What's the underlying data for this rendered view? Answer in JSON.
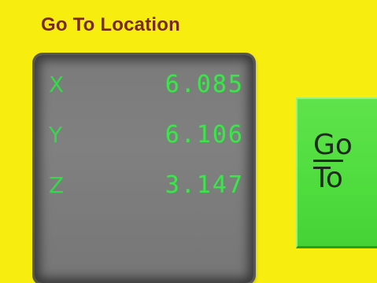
{
  "panel": {
    "title": "Go To Location"
  },
  "coordinates": [
    {
      "axis": "X",
      "value": "6.085"
    },
    {
      "axis": "Y",
      "value": "6.106"
    },
    {
      "axis": "Z",
      "value": "3.147"
    }
  ],
  "go_button": {
    "line1": "Go",
    "line2": "To"
  },
  "colors": {
    "background": "#f7ee0f",
    "title": "#7a2a12",
    "readout_bg": "#7b7b7b",
    "digits": "#3fe34d",
    "button": "#4fdc3d"
  }
}
